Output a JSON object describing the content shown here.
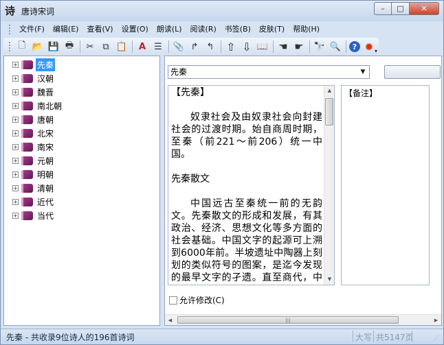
{
  "window": {
    "title": "唐诗宋词",
    "app_icon_glyph": "诗"
  },
  "window_controls": {
    "minimize": "–",
    "maximize": "□",
    "close": "✕"
  },
  "menu": {
    "items": [
      "文件(F)",
      "编辑(E)",
      "查看(V)",
      "设置(O)",
      "朗读(L)",
      "阅读(R)",
      "书签(B)",
      "皮肤(T)",
      "帮助(H)"
    ]
  },
  "toolbar": {
    "buttons": [
      {
        "icon": "new-file-icon",
        "glyph": "🗋"
      },
      {
        "icon": "open-folder-icon",
        "glyph": "📂"
      },
      {
        "icon": "save-icon",
        "glyph": "💾"
      },
      {
        "icon": "print-icon",
        "glyph": "🖶"
      },
      {
        "icon": "cut-icon",
        "glyph": "✂"
      },
      {
        "icon": "copy-icon",
        "glyph": "⧉"
      },
      {
        "icon": "paste-icon",
        "glyph": "📋"
      },
      {
        "icon": "font-color-icon",
        "glyph": "A"
      },
      {
        "icon": "align-icon",
        "glyph": "☰"
      },
      {
        "icon": "paperclip-icon",
        "glyph": "📎"
      },
      {
        "icon": "bookmark-next-icon",
        "glyph": "↱"
      },
      {
        "icon": "bookmark-prev-icon",
        "glyph": "↰"
      },
      {
        "icon": "arrow-up-icon",
        "glyph": "⇧"
      },
      {
        "icon": "arrow-down-icon",
        "glyph": "⇩"
      },
      {
        "icon": "book-icon",
        "glyph": "📖"
      },
      {
        "icon": "hand-left-icon",
        "glyph": "☚"
      },
      {
        "icon": "hand-right-icon",
        "glyph": "☛"
      },
      {
        "icon": "find-icon",
        "glyph": "🔭"
      },
      {
        "icon": "search-icon",
        "glyph": "🔍"
      },
      {
        "icon": "help-icon",
        "glyph": "?"
      },
      {
        "icon": "skin-icon",
        "glyph": "✹"
      }
    ]
  },
  "tree": {
    "items": [
      {
        "label": "先秦",
        "selected": true
      },
      {
        "label": "汉朝",
        "selected": false
      },
      {
        "label": "魏晋",
        "selected": false
      },
      {
        "label": "南北朝",
        "selected": false
      },
      {
        "label": "唐朝",
        "selected": false
      },
      {
        "label": "北宋",
        "selected": false
      },
      {
        "label": "南宋",
        "selected": false
      },
      {
        "label": "元朝",
        "selected": false
      },
      {
        "label": "明朝",
        "selected": false
      },
      {
        "label": "清朝",
        "selected": false
      },
      {
        "label": "近代",
        "selected": false
      },
      {
        "label": "当代",
        "selected": false
      }
    ]
  },
  "dynasty_select": {
    "value": "先秦"
  },
  "content": {
    "heading": "【先秦】",
    "para1": "奴隶社会及由奴隶社会向封建社会的过渡时期。始自商周时期，至秦（前221～前206）统一中国。",
    "section": "先秦散文",
    "para2": "中国远古至秦统一前的无韵文。先秦散文的形成和发展，有其政治、经济、思想文化等多方面的社会基础。中国文字的起源可上溯到6000年前。半坡遗址中陶器上刻划的类似符号的图案，是迄今发现的最早文字的孑遗。直至商代，中国才有了比较成熟的文字，这"
  },
  "notes": {
    "heading": "【备注】"
  },
  "allow_edit": {
    "label": "允许修改(C)",
    "checked": false
  },
  "status": {
    "left": "先秦 - 共收录9位诗人的196首诗词",
    "mid": "大写",
    "right": "共5147页"
  },
  "colors": {
    "selection": "#3399ff",
    "book": "#7b2366",
    "window_bg": "#d6e3f3"
  }
}
